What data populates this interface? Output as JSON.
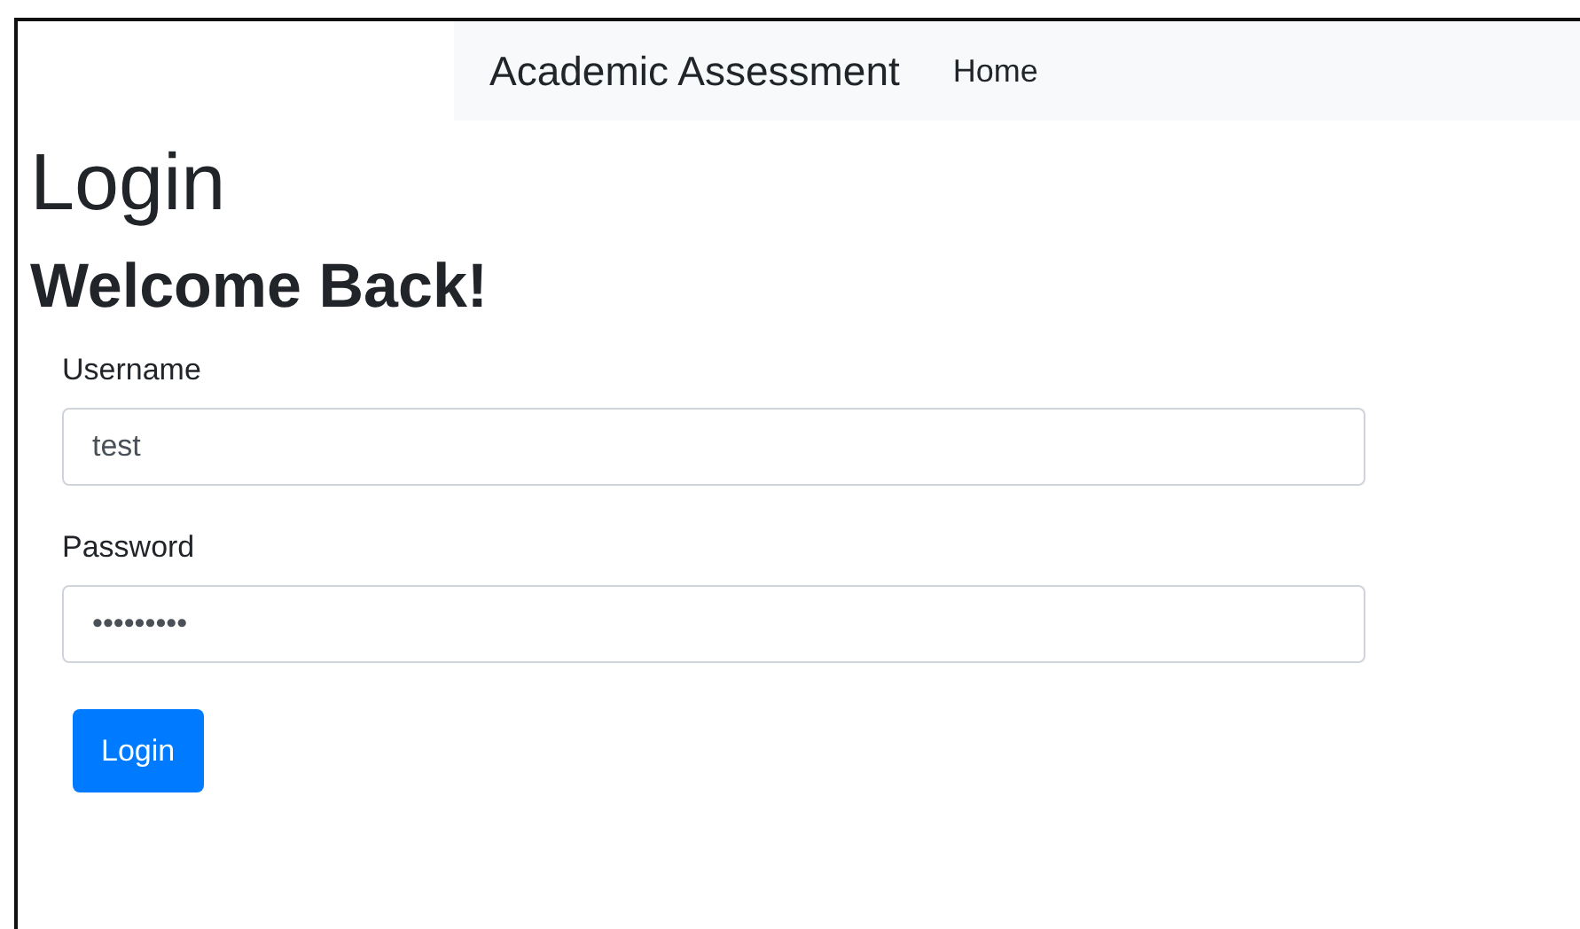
{
  "navbar": {
    "brand": "Academic Assessment",
    "links": [
      {
        "label": "Home"
      }
    ]
  },
  "heading": "Login",
  "subheading": "Welcome Back!",
  "form": {
    "fields": [
      {
        "label": "Username",
        "value": "test"
      },
      {
        "label": "Password",
        "value": "•••••••••"
      }
    ],
    "submit": "Login"
  }
}
